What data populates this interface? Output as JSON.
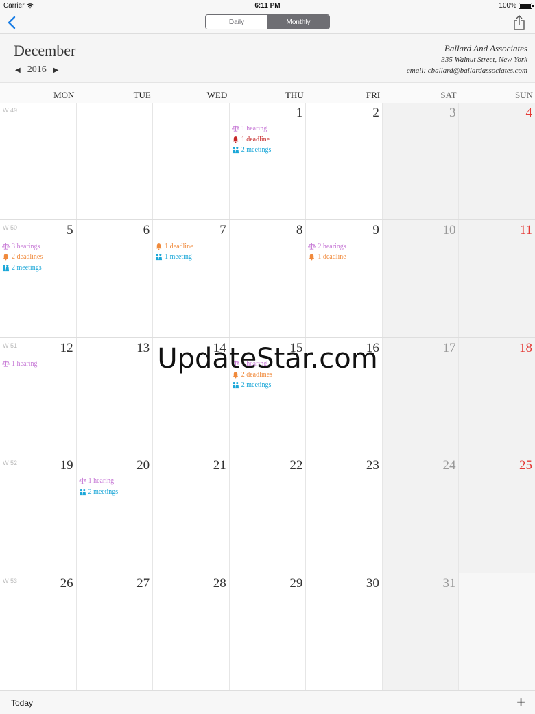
{
  "status": {
    "carrier": "Carrier",
    "time": "6:11 PM",
    "battery": "100%"
  },
  "nav": {
    "daily": "Daily",
    "monthly": "Monthly"
  },
  "header": {
    "month": "December",
    "year": "2016",
    "firm_name": "Ballard And Associates",
    "firm_address": "335 Walnut Street, New York",
    "firm_email": "email: cballard@ballardassociates.com"
  },
  "weekdays": [
    "MON",
    "TUE",
    "WED",
    "THU",
    "FRI",
    "SAT",
    "SUN"
  ],
  "colors": {
    "hearing": "#c77ad6",
    "deadline": "#f08a3c",
    "deadline_urgent": "#c62828",
    "meeting": "#1ba7d8",
    "sunday": "#e53935"
  },
  "weeks": [
    {
      "label": "W 49",
      "days": [
        {
          "num": "",
          "events": []
        },
        {
          "num": "",
          "events": []
        },
        {
          "num": "",
          "events": []
        },
        {
          "num": "1",
          "events": [
            {
              "type": "hearing",
              "text": "1 hearing"
            },
            {
              "type": "deadline_urgent",
              "text": "1 deadline"
            },
            {
              "type": "meeting",
              "text": "2 meetings"
            }
          ]
        },
        {
          "num": "2",
          "events": []
        },
        {
          "num": "3",
          "events": []
        },
        {
          "num": "4",
          "events": []
        }
      ]
    },
    {
      "label": "W 50",
      "days": [
        {
          "num": "5",
          "events": [
            {
              "type": "hearing",
              "text": "3 hearings"
            },
            {
              "type": "deadline",
              "text": "2 deadlines"
            },
            {
              "type": "meeting",
              "text": "2 meetings"
            }
          ]
        },
        {
          "num": "6",
          "events": []
        },
        {
          "num": "7",
          "events": [
            {
              "type": "deadline",
              "text": "1 deadline"
            },
            {
              "type": "meeting",
              "text": "1 meeting"
            }
          ]
        },
        {
          "num": "8",
          "events": []
        },
        {
          "num": "9",
          "events": [
            {
              "type": "hearing",
              "text": "2 hearings"
            },
            {
              "type": "deadline",
              "text": "1 deadline"
            }
          ]
        },
        {
          "num": "10",
          "events": []
        },
        {
          "num": "11",
          "events": []
        }
      ]
    },
    {
      "label": "W 51",
      "days": [
        {
          "num": "12",
          "events": [
            {
              "type": "hearing",
              "text": "1 hearing"
            }
          ]
        },
        {
          "num": "13",
          "events": []
        },
        {
          "num": "14",
          "events": []
        },
        {
          "num": "15",
          "events": [
            {
              "type": "hearing",
              "text": "1 hearing"
            },
            {
              "type": "deadline",
              "text": "2 deadlines"
            },
            {
              "type": "meeting",
              "text": "2 meetings"
            }
          ]
        },
        {
          "num": "16",
          "events": []
        },
        {
          "num": "17",
          "events": []
        },
        {
          "num": "18",
          "events": []
        }
      ]
    },
    {
      "label": "W 52",
      "days": [
        {
          "num": "19",
          "events": []
        },
        {
          "num": "20",
          "events": [
            {
              "type": "hearing",
              "text": "1 hearing"
            },
            {
              "type": "meeting",
              "text": "2 meetings"
            }
          ]
        },
        {
          "num": "21",
          "events": []
        },
        {
          "num": "22",
          "events": []
        },
        {
          "num": "23",
          "events": []
        },
        {
          "num": "24",
          "events": []
        },
        {
          "num": "25",
          "events": []
        }
      ]
    },
    {
      "label": "W 53",
      "days": [
        {
          "num": "26",
          "events": []
        },
        {
          "num": "27",
          "events": []
        },
        {
          "num": "28",
          "events": []
        },
        {
          "num": "29",
          "events": []
        },
        {
          "num": "30",
          "events": []
        },
        {
          "num": "31",
          "events": []
        },
        {
          "num": "",
          "events": []
        }
      ]
    }
  ],
  "watermark": "UpdateStar.com",
  "toolbar": {
    "today": "Today",
    "add": "+"
  }
}
